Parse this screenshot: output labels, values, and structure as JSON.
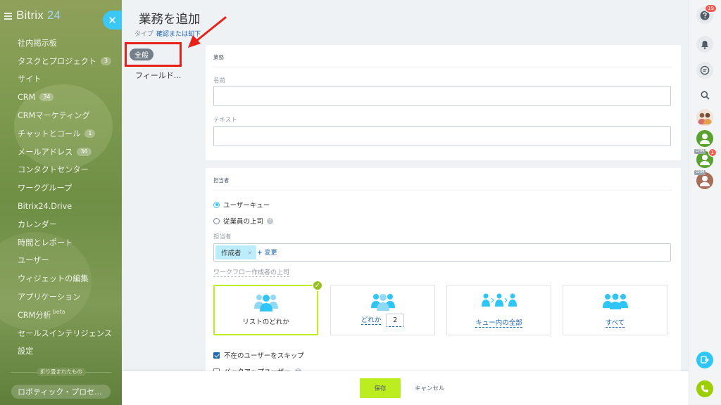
{
  "sidebar": {
    "logo_main": "Bitrix",
    "logo_num": "24",
    "close_glyph": "✕",
    "items": [
      {
        "label": "社内掲示板",
        "counter": ""
      },
      {
        "label": "タスクとプロジェクト",
        "counter": "3"
      },
      {
        "label": "サイト",
        "counter": ""
      },
      {
        "label": "CRM",
        "counter": "34"
      },
      {
        "label": "CRMマーケティング",
        "counter": ""
      },
      {
        "label": "チャットとコール",
        "counter": "1"
      },
      {
        "label": "メールアドレス",
        "counter": "36"
      },
      {
        "label": "コンタクトセンター",
        "counter": ""
      },
      {
        "label": "ワークグループ",
        "counter": ""
      },
      {
        "label": "Bitrix24.Drive",
        "counter": ""
      },
      {
        "label": "カレンダー",
        "counter": ""
      },
      {
        "label": "時間とレポート",
        "counter": ""
      },
      {
        "label": "ユーザー",
        "counter": ""
      },
      {
        "label": "ウィジェットの編集",
        "counter": ""
      },
      {
        "label": "アプリケーション",
        "counter": ""
      },
      {
        "label": "CRM分析",
        "counter": "",
        "beta": "beta"
      },
      {
        "label": "セールスインテリジェンス",
        "counter": ""
      },
      {
        "label": "設定",
        "counter": ""
      }
    ],
    "collapsed_label": "折り畳まれたもの",
    "robotic_label": "ロボティック・プロセ..."
  },
  "slider": {
    "title": "業務を追加",
    "type_label": "タイプ",
    "type_value": "確認または却下",
    "nav_active": "全般",
    "nav_second": "フィールド..."
  },
  "task_card": {
    "section_title": "業務",
    "name_label": "名前",
    "name_value": "",
    "text_label": "テキスト",
    "text_value": ""
  },
  "assignee_card": {
    "section_title": "担当者",
    "radio_user_queue": "ユーザーキュー",
    "radio_supervisor": "従業員の上司",
    "help_glyph": "?",
    "assignee_label": "担当者",
    "assignee_tag": "作成者",
    "tag_remove": "×",
    "change_plus": "+",
    "change_label": "変更",
    "workflow_label": "ワークフロー作成者の上司",
    "tiles": [
      {
        "label": "リストのどれか"
      },
      {
        "label": "どれか",
        "number": "2"
      },
      {
        "label": "キュー内の全部"
      },
      {
        "label": "すべて"
      }
    ],
    "check_glyph": "✓",
    "skip_absent": "不在のユーザーをスキップ",
    "backup_user": "バックアップユーザー"
  },
  "footer": {
    "save": "保存",
    "cancel": "キャンセル"
  },
  "rightbar": {
    "help_badge": "19",
    "crm_tag": "CRM",
    "crm_badge": "1"
  },
  "colors": {
    "accent_blue": "#2fc6f6",
    "link_blue": "#2067b0",
    "save_green": "#bbed21",
    "highlight_red": "#e8201a"
  }
}
